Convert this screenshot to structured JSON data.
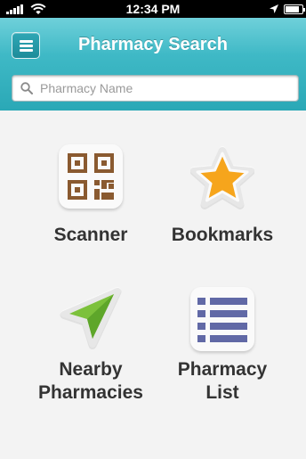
{
  "status_bar": {
    "time": "12:34 PM",
    "battery_level": 0.85
  },
  "header": {
    "title": "Pharmacy Search",
    "menu_icon": "hamburger-menu-icon"
  },
  "search": {
    "placeholder": "Pharmacy Name",
    "value": "",
    "icon": "search-icon"
  },
  "tiles": [
    {
      "id": "scanner",
      "label_lines": [
        "Scanner"
      ],
      "icon": "qr-code-icon",
      "color": "#8a5a30"
    },
    {
      "id": "bookmarks",
      "label_lines": [
        "Bookmarks"
      ],
      "icon": "star-icon",
      "color": "#f6a51c"
    },
    {
      "id": "nearby",
      "label_lines": [
        "Nearby",
        "Pharmacies"
      ],
      "icon": "location-arrow-icon",
      "color": "#7cc13b"
    },
    {
      "id": "pharmacy-list",
      "label_lines": [
        "Pharmacy",
        "List"
      ],
      "icon": "list-icon",
      "color": "#6169a6"
    }
  ],
  "colors": {
    "header_top": "#6fd0da",
    "header_bottom": "#2aa8b6",
    "label_text": "#333333",
    "background": "#f3f3f3"
  }
}
